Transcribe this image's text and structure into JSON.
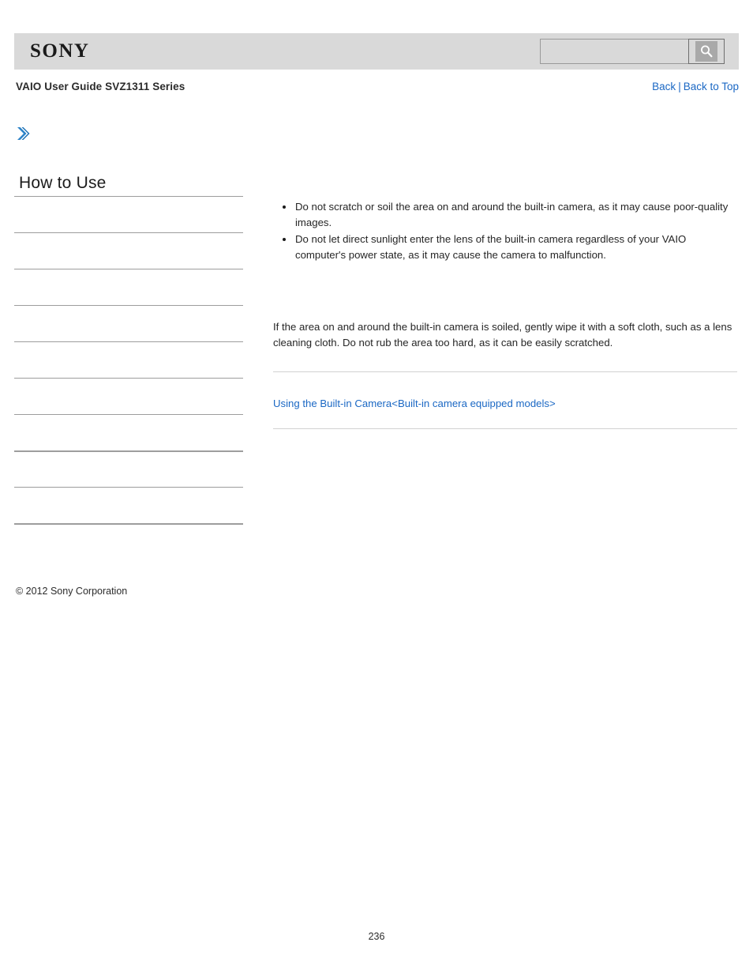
{
  "header": {
    "brand": "SONY",
    "search": {
      "value": "",
      "placeholder": "",
      "icon": "search-icon",
      "button_label": ""
    }
  },
  "subheader": {
    "guide_title": "VAIO User Guide SVZ1311 Series",
    "nav": {
      "back": "Back",
      "separator": "|",
      "back_to_top": "Back to Top"
    }
  },
  "sidebar": {
    "arrow_icon": "double-chevron-right-icon",
    "title": "How to Use",
    "items": [
      {
        "label": "",
        "thick": false
      },
      {
        "label": "",
        "thick": false
      },
      {
        "label": "",
        "thick": false
      },
      {
        "label": "",
        "thick": false
      },
      {
        "label": "",
        "thick": false
      },
      {
        "label": "",
        "thick": false
      },
      {
        "label": "",
        "thick": false
      },
      {
        "label": "",
        "thick": true
      },
      {
        "label": "",
        "thick": false
      },
      {
        "label": "",
        "thick": true
      }
    ]
  },
  "main": {
    "notes": [
      "Do not scratch or soil the area on and around the built-in camera, as it may cause poor-quality images.",
      "Do not let direct sunlight enter the lens of the built-in camera regardless of your VAIO computer's power state, as it may cause the camera to malfunction."
    ],
    "paragraph": "If the area on and around the built-in camera is soiled, gently wipe it with a soft cloth, such as a lens cleaning cloth. Do not rub the area too hard, as it can be easily scratched.",
    "related_link": "Using the Built-in Camera<Built-in camera equipped models>"
  },
  "footer": {
    "copyright": "© 2012 Sony Corporation",
    "page_number": "236"
  },
  "colors": {
    "link": "#1b68c4",
    "header_band": "#d9d9d9",
    "accent_arrow": "#2b82c8",
    "rule": "#d2d2d2",
    "toc_rule": "#9d9d9d"
  }
}
